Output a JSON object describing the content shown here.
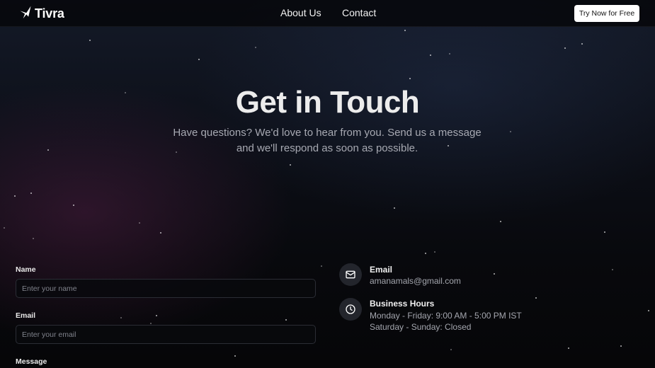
{
  "header": {
    "logo_text": "Tivra",
    "nav": [
      "About Us",
      "Contact"
    ],
    "cta_label": "Try Now for Free"
  },
  "hero": {
    "title": "Get in Touch",
    "subtitle": "Have questions? We'd love to hear from you. Send us a message and we'll respond as soon as possible."
  },
  "form": {
    "name_label": "Name",
    "name_placeholder": "Enter your name",
    "email_label": "Email",
    "email_placeholder": "Enter your email",
    "message_label": "Message"
  },
  "info": {
    "email_title": "Email",
    "email_value": "amanamals@gmail.com",
    "hours_title": "Business Hours",
    "hours_weekday": "Monday - Friday: 9:00 AM - 5:00 PM IST",
    "hours_weekend": "Saturday - Sunday: Closed"
  },
  "icons": {
    "logo": "sparkle-icon",
    "email": "mail-icon",
    "hours": "clock-icon"
  }
}
